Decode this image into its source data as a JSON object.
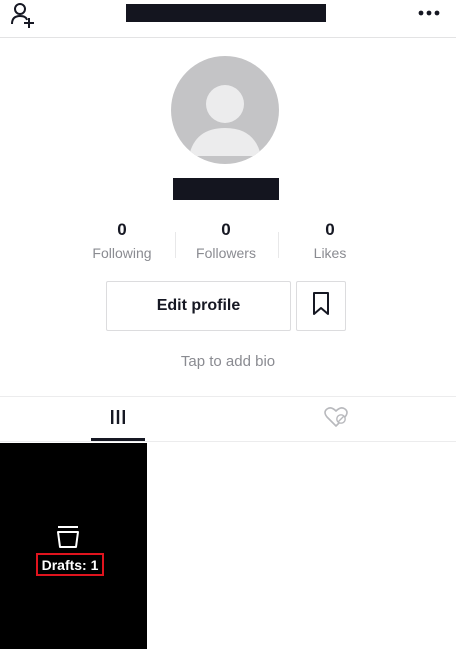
{
  "profile": {
    "stats": [
      {
        "value": "0",
        "label": "Following"
      },
      {
        "value": "0",
        "label": "Followers"
      },
      {
        "value": "0",
        "label": "Likes"
      }
    ],
    "edit_profile_label": "Edit profile",
    "bio_placeholder": "Tap to add bio"
  },
  "drafts": {
    "label": "Drafts: 1"
  },
  "icons": {
    "top_left": "add-user-icon",
    "top_right": "more-options-icon",
    "bookmark": "bookmark-icon",
    "videos_tab": "grid-icon",
    "liked_tab": "liked-heart-icon",
    "drafts": "drafts-icon"
  },
  "colors": {
    "highlight_border": "#e0141e",
    "primary_text": "#161823",
    "secondary_text": "#8a8b91"
  }
}
